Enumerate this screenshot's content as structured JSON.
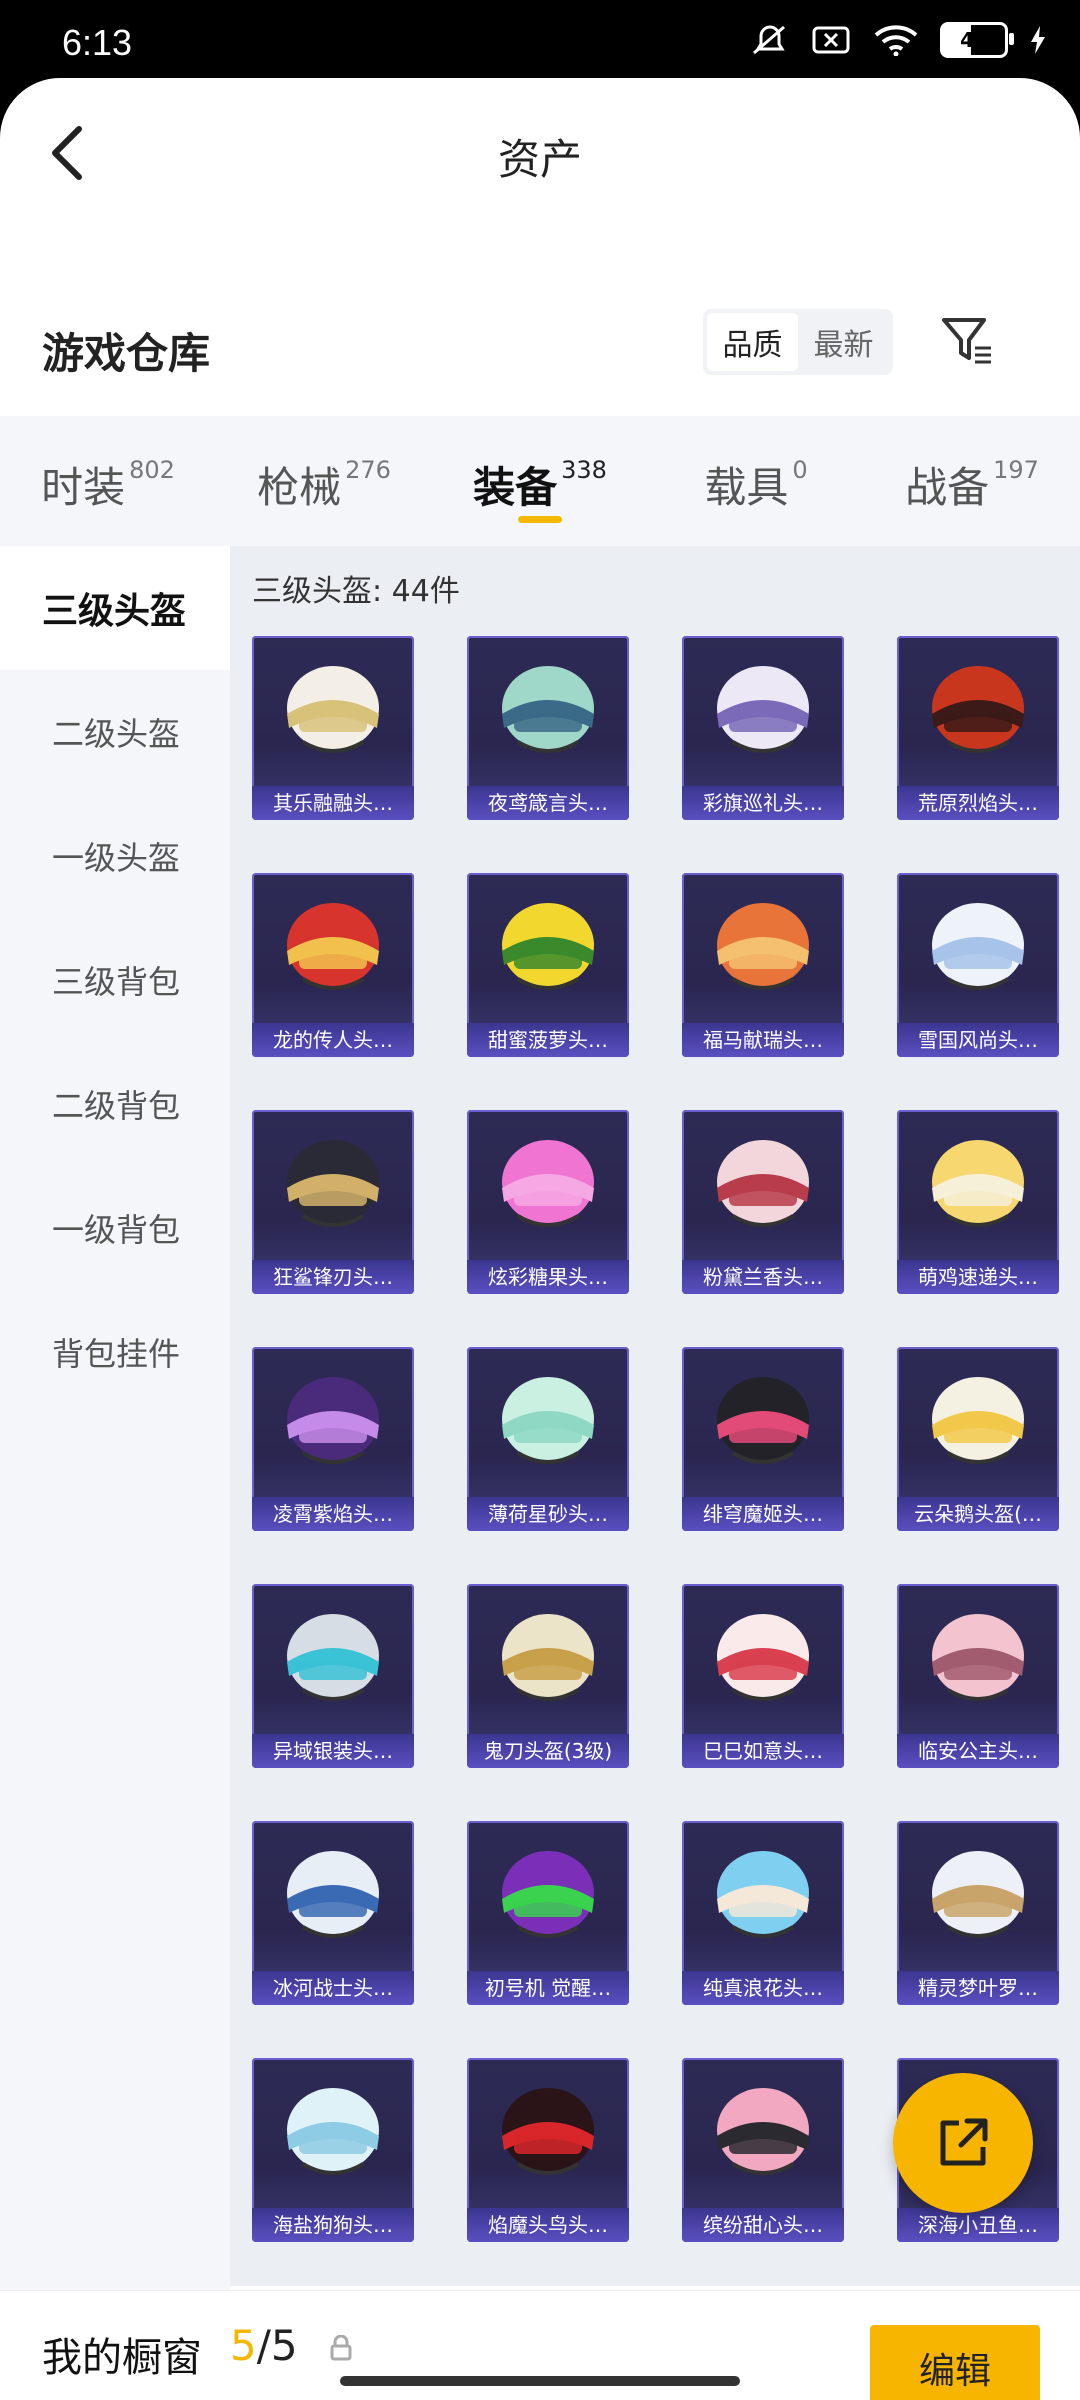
{
  "status_bar": {
    "time": "6:13",
    "battery": "45"
  },
  "header": {
    "title": "资产"
  },
  "section": {
    "title": "游戏仓库",
    "sort_options": [
      "品质",
      "最新"
    ]
  },
  "tabs": [
    {
      "label": "时装",
      "count": "802"
    },
    {
      "label": "枪械",
      "count": "276"
    },
    {
      "label": "装备",
      "count": "338"
    },
    {
      "label": "载具",
      "count": "0"
    },
    {
      "label": "战备",
      "count": "197"
    }
  ],
  "sidebar": {
    "items": [
      "三级头盔",
      "二级头盔",
      "一级头盔",
      "三级背包",
      "二级背包",
      "一级背包",
      "背包挂件"
    ]
  },
  "content": {
    "count_label": "三级头盔: 44件"
  },
  "items": [
    {
      "name": "其乐融融头…",
      "colors": [
        "#f4efe6",
        "#d8c27a"
      ]
    },
    {
      "name": "夜鸢箴言头…",
      "colors": [
        "#9fd8c8",
        "#3a6a88"
      ]
    },
    {
      "name": "彩旗巡礼头…",
      "colors": [
        "#ece8f5",
        "#7a6ab8"
      ]
    },
    {
      "name": "荒原烈焰头…",
      "colors": [
        "#c8361e",
        "#3b1a18"
      ]
    },
    {
      "name": "龙的传人头…",
      "colors": [
        "#d6342c",
        "#f2c14d"
      ]
    },
    {
      "name": "甜蜜菠萝头…",
      "colors": [
        "#f2d82e",
        "#3a8a2c"
      ]
    },
    {
      "name": "福马献瑞头…",
      "colors": [
        "#e8743a",
        "#f4c070"
      ]
    },
    {
      "name": "雪国风尚头…",
      "colors": [
        "#eef3fa",
        "#a7c3ea"
      ]
    },
    {
      "name": "狂鲨锋刃头…",
      "colors": [
        "#2a2a36",
        "#d2b06a"
      ]
    },
    {
      "name": "炫彩糖果头…",
      "colors": [
        "#f074d2",
        "#f6a8e4"
      ]
    },
    {
      "name": "粉黛兰香头…",
      "colors": [
        "#f2d6dc",
        "#b83c4a"
      ]
    },
    {
      "name": "萌鸡速递头…",
      "colors": [
        "#f6d770",
        "#f6f0d8"
      ]
    },
    {
      "name": "凌霄紫焰头…",
      "colors": [
        "#4a2a7a",
        "#c58be8"
      ]
    },
    {
      "name": "薄荷星砂头…",
      "colors": [
        "#c9f0e0",
        "#8ed8c4"
      ]
    },
    {
      "name": "绯穹魔姬头…",
      "colors": [
        "#222228",
        "#e24a78"
      ]
    },
    {
      "name": "云朵鹅头盔(…",
      "colors": [
        "#f4f1e2",
        "#f2c84a"
      ]
    },
    {
      "name": "异域银装头…",
      "colors": [
        "#d6dde4",
        "#3ac2d6"
      ]
    },
    {
      "name": "鬼刀头盔(3级)",
      "colors": [
        "#ece4c8",
        "#c9a04a"
      ]
    },
    {
      "name": "巳巳如意头…",
      "colors": [
        "#fbeaea",
        "#d94050"
      ]
    },
    {
      "name": "临安公主头…",
      "colors": [
        "#f3c4cf",
        "#a25c70"
      ]
    },
    {
      "name": "冰河战士头…",
      "colors": [
        "#e8eef6",
        "#3b6ab4"
      ]
    },
    {
      "name": "初号机 觉醒…",
      "colors": [
        "#7b2fb8",
        "#3ad24e"
      ]
    },
    {
      "name": "纯真浪花头…",
      "colors": [
        "#7fd0f0",
        "#f4e8d8"
      ]
    },
    {
      "name": "精灵梦叶罗…",
      "colors": [
        "#eef0f8",
        "#c9a46a"
      ]
    },
    {
      "name": "海盐狗狗头…",
      "colors": [
        "#dff2f8",
        "#8ecbe4"
      ]
    },
    {
      "name": "焰魔头鸟头…",
      "colors": [
        "#2a1418",
        "#d8262a"
      ]
    },
    {
      "name": "缤纷甜心头…",
      "colors": [
        "#f2a8c0",
        "#2a2a30"
      ]
    },
    {
      "name": "深海小丑鱼…",
      "colors": [
        "#56c6c0",
        "#f28a2c"
      ]
    }
  ],
  "bottom": {
    "window_label": "我的橱窗",
    "used": "5",
    "total": "/5",
    "edit": "编辑"
  },
  "accent": "#f7b500"
}
